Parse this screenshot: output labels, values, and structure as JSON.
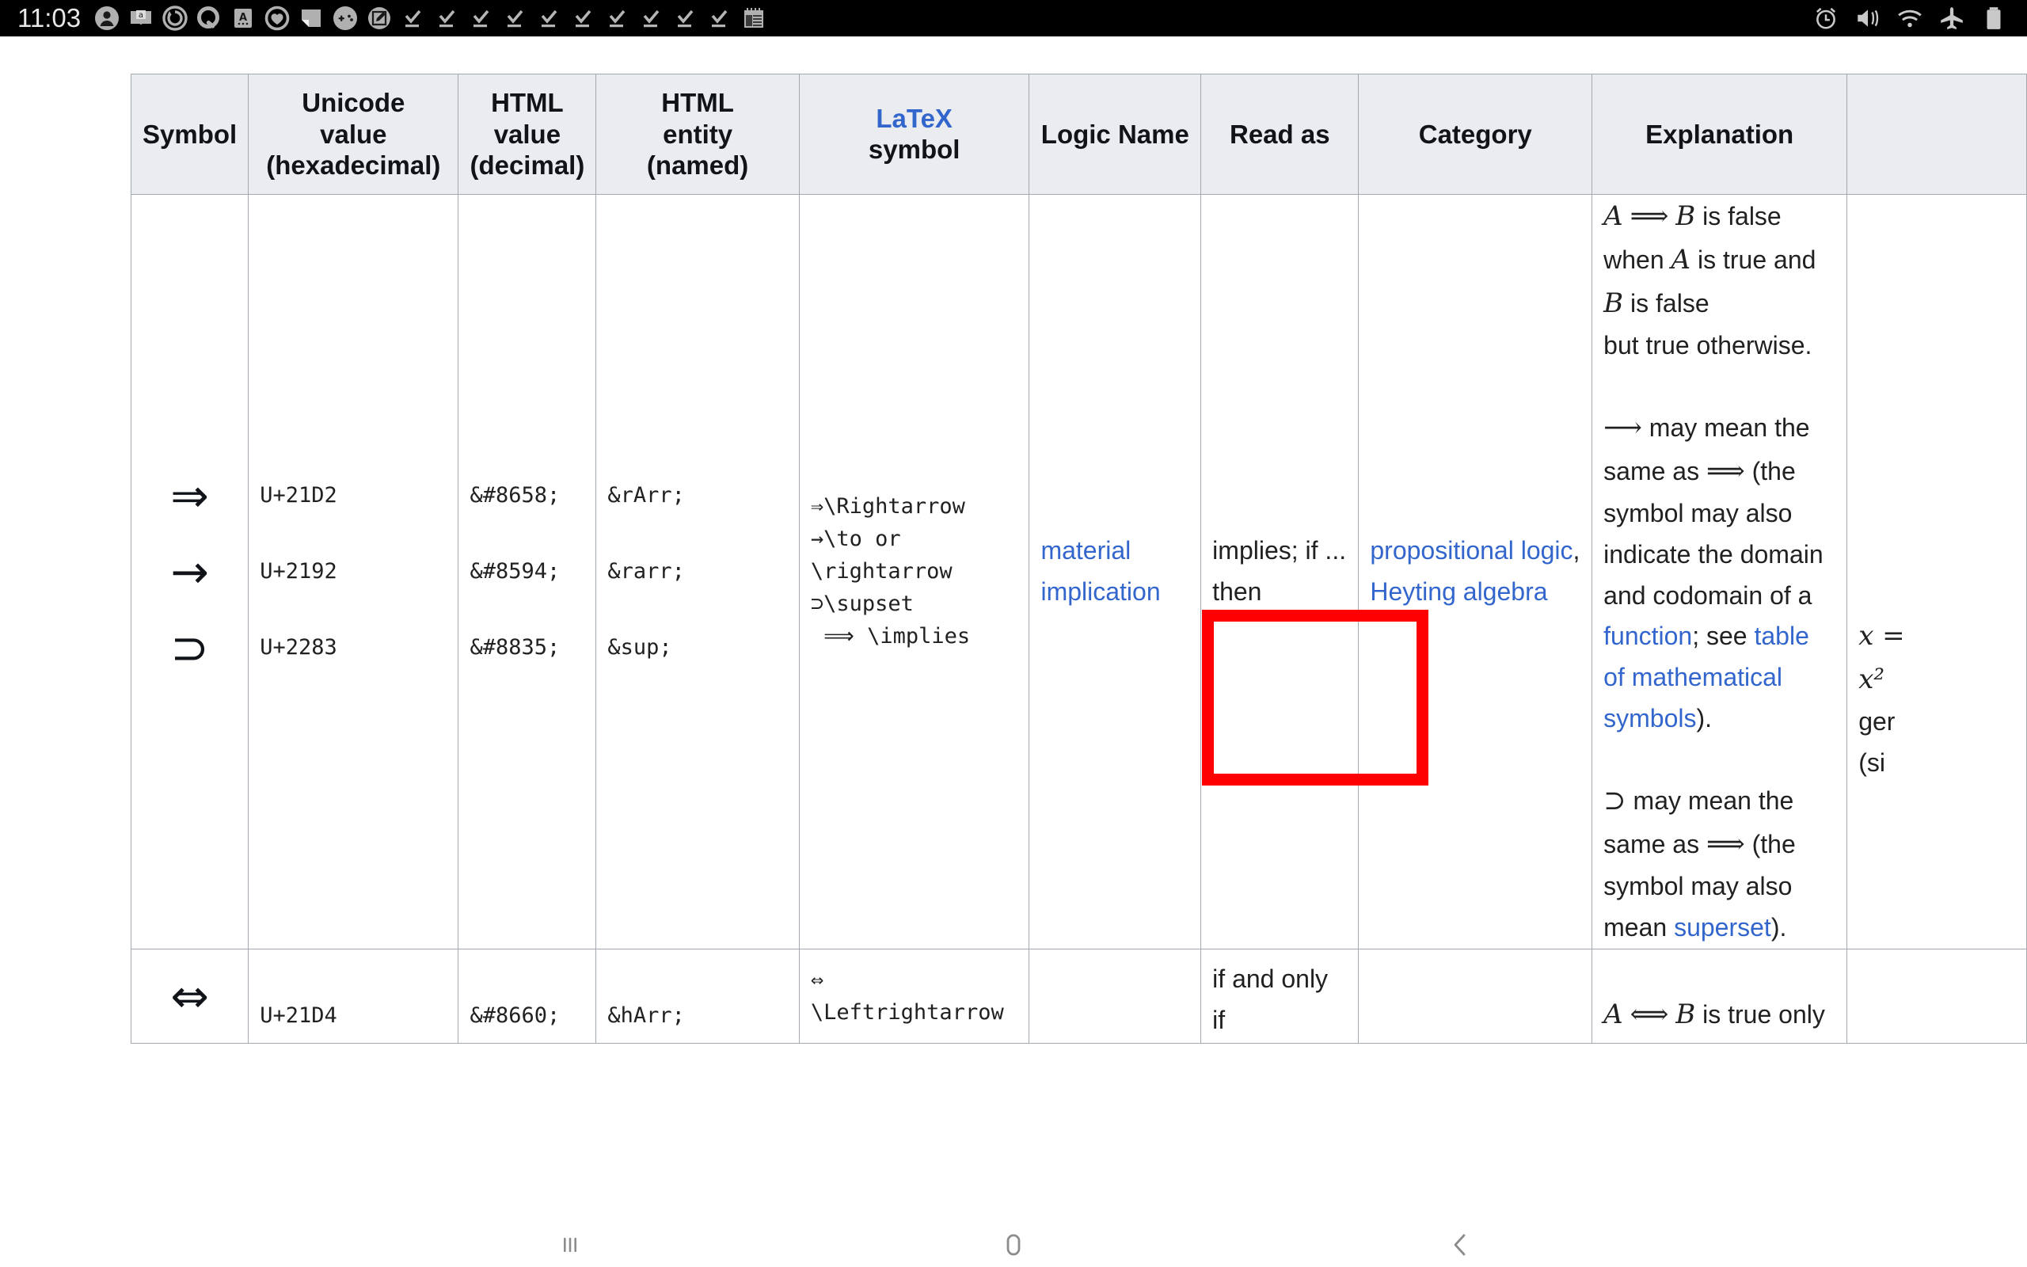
{
  "statusbar": {
    "clock": "11:03",
    "left_icons": [
      "contact-icon",
      "book-icon",
      "sync-icon",
      "quora-icon",
      "anki-icon",
      "heart-circle-icon",
      "note-icon",
      "gamepad-icon",
      "edit-square-icon",
      "download-complete-icon",
      "download-complete-icon",
      "download-complete-icon",
      "download-complete-icon",
      "download-complete-icon",
      "download-complete-icon",
      "download-complete-icon",
      "download-complete-icon",
      "download-complete-icon",
      "download-complete-icon",
      "calendar-icon"
    ],
    "right_icons": [
      "alarm-icon",
      "mute-vibrate-icon",
      "wifi-icon",
      "airplane-mode-icon",
      "battery-icon"
    ]
  },
  "table": {
    "headers": [
      {
        "id": "symbol",
        "lines": [
          "Symbol"
        ]
      },
      {
        "id": "unicode",
        "lines": [
          "Unicode",
          "value",
          "(hexadecimal)"
        ]
      },
      {
        "id": "htmlval",
        "lines": [
          "HTML",
          "value",
          "(decimal)"
        ]
      },
      {
        "id": "htmlent",
        "lines": [
          "HTML",
          "entity",
          "(named)"
        ]
      },
      {
        "id": "latex",
        "lines": [
          "LaTeX",
          "symbol"
        ],
        "link_line": 0
      },
      {
        "id": "logic",
        "lines": [
          "Logic Name"
        ]
      },
      {
        "id": "readas",
        "lines": [
          "Read as"
        ]
      },
      {
        "id": "category",
        "lines": [
          "Category"
        ]
      },
      {
        "id": "explanation",
        "lines": [
          "Explanation"
        ]
      }
    ],
    "rows": [
      {
        "symbols": [
          "⇒",
          "→",
          "⊃"
        ],
        "unicode": [
          "U+21D2",
          "U+2192",
          "U+2283"
        ],
        "html_decimal": [
          "&#8658;",
          "&#8594;",
          "&#8835;"
        ],
        "html_entity": [
          "&rArr;",
          "&rarr;",
          "&sup;"
        ],
        "latex": "⇒\\Rightarrow\n→\\to or\n\\rightarrow\n⊃\\supset\n ⟹ \\implies",
        "logic_name": "material implication",
        "read_as": "implies; if ... then",
        "category_1": "propositional logic",
        "category_sep": ",",
        "category_2": "Heyting algebra",
        "explanation": {
          "p1_a": "A",
          "p1_op": "⟹",
          "p1_b": "B",
          "p1_rest": " is false when ",
          "p1_a2": "A",
          "p1_rest2": " is true and ",
          "p1_b2": "B",
          "p1_rest3": " is false",
          "p1_line2": "but true otherwise.",
          "p2_arrow": "⟶",
          "p2_t1": " may mean the same as ",
          "p2_arrow2": "⟹",
          "p2_t2": " (the symbol may also indicate the domain and codomain of a ",
          "p2_link1": "function",
          "p2_t3": "; see ",
          "p2_link2": "table of mathematical symbols",
          "p2_t4": ").",
          "p3_sup": "⊃",
          "p3_t1": " may mean the same as ",
          "p3_arrow": "⟹",
          "p3_t2": " (the symbol may also mean ",
          "p3_link": "superset",
          "p3_t3": ")."
        },
        "example_partial": [
          "x =",
          "x²",
          "ger",
          "(si"
        ]
      },
      {
        "symbols": [
          "⇔"
        ],
        "unicode": [
          "U+21D4"
        ],
        "html_decimal": [
          "&#8660;"
        ],
        "html_entity": [
          "&hArr;"
        ],
        "latex": "⇔\n\\Leftrightarrow",
        "logic_name": "",
        "read_as": "if and only if",
        "category_1": "",
        "explanation": {
          "p1_a": "A",
          "p1_op": "⟺",
          "p1_b": "B",
          "p1_rest": " is true only"
        }
      }
    ]
  },
  "overlay": {
    "highlight_name": "read-as-cell-highlight",
    "highlight_color": "#ff0000"
  },
  "navbar": {
    "recents_label": "recents-button",
    "home_label": "home-button",
    "back_label": "back-button"
  }
}
